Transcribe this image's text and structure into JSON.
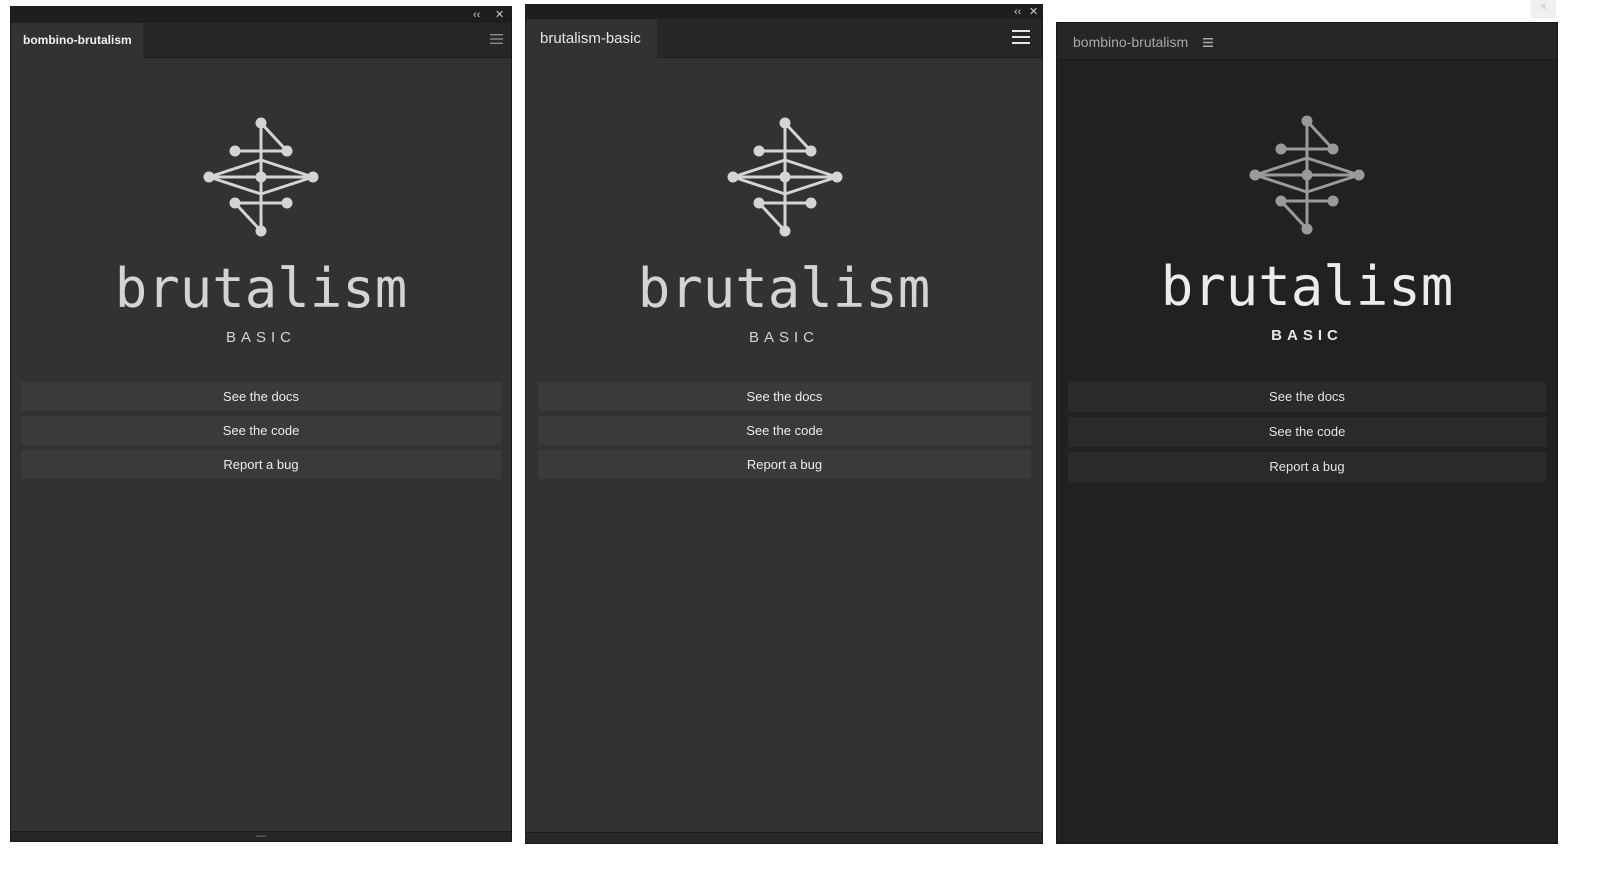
{
  "panels": [
    {
      "tab_label": "bombino-brutalism",
      "brand": "brutalism",
      "subtitle": "BASIC",
      "buttons": [
        "See the docs",
        "See the code",
        "Report a bug"
      ]
    },
    {
      "tab_label": "brutalism-basic",
      "brand": "brutalism",
      "subtitle": "BASIC",
      "buttons": [
        "See the docs",
        "See the code",
        "Report a bug"
      ]
    },
    {
      "tab_label": "bombino-brutalism",
      "brand": "brutalism",
      "subtitle": "BASIC",
      "buttons": [
        "See the docs",
        "See the code",
        "Report a bug"
      ]
    }
  ],
  "window_controls": {
    "collapse": "‹‹",
    "close": "✕"
  },
  "colors": {
    "panel_bg": "#323232",
    "panel3_bg": "#212121",
    "button_bg": "#3a3a3a",
    "logo_light": "#d4d4d4",
    "logo_dim": "#9a9a9a"
  }
}
